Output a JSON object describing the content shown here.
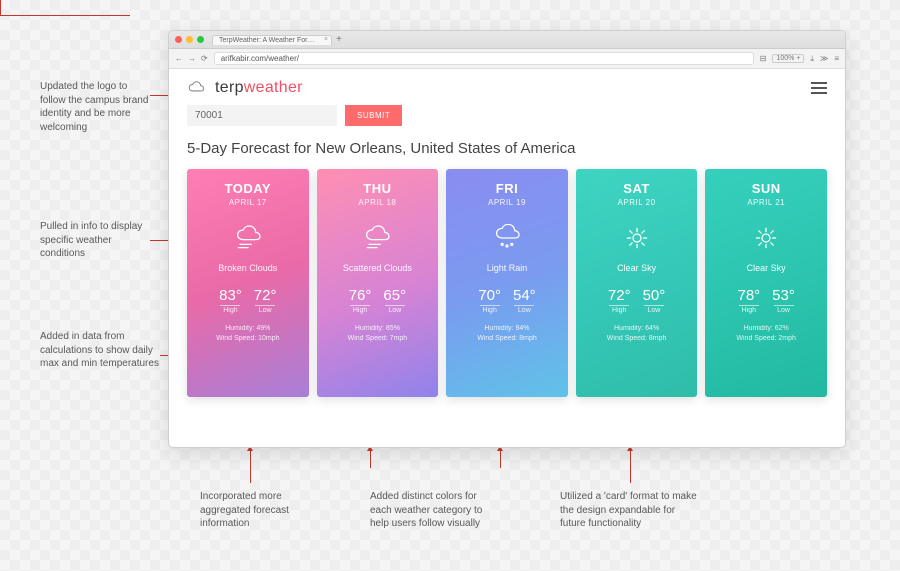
{
  "browser": {
    "tab_title": "TerpWeather: A Weather Forecast…",
    "url": "arifkabir.com/weather/",
    "zoom": "100%"
  },
  "logo": {
    "part1": "terp",
    "part2": "weather"
  },
  "search": {
    "zip_value": "70001",
    "submit_label": "SUBMIT"
  },
  "heading": "5-Day Forecast for New Orleans, United States of America",
  "forecast": [
    {
      "day": "TODAY",
      "date": "APRIL 17",
      "condition": "Broken Clouds",
      "icon": "cloud-wind",
      "high": "83°",
      "low": "72°",
      "humidity": "Humidity: 49%",
      "wind": "Wind Speed: 10mph"
    },
    {
      "day": "THU",
      "date": "APRIL 18",
      "condition": "Scattered Clouds",
      "icon": "cloud-wind",
      "high": "76°",
      "low": "65°",
      "humidity": "Humidity: 85%",
      "wind": "Wind Speed: 7mph"
    },
    {
      "day": "FRI",
      "date": "APRIL 19",
      "condition": "Light Rain",
      "icon": "cloud-rain",
      "high": "70°",
      "low": "54°",
      "humidity": "Humidity: 94%",
      "wind": "Wind Speed: 8mph"
    },
    {
      "day": "SAT",
      "date": "APRIL 20",
      "condition": "Clear Sky",
      "icon": "sun",
      "high": "72°",
      "low": "50°",
      "humidity": "Humidity: 64%",
      "wind": "Wind Speed: 8mph"
    },
    {
      "day": "SUN",
      "date": "APRIL 21",
      "condition": "Clear Sky",
      "icon": "sun",
      "high": "78°",
      "low": "53°",
      "humidity": "Humidity: 62%",
      "wind": "Wind Speed: 2mph"
    }
  ],
  "labels": {
    "high": "High",
    "low": "Low"
  },
  "annotations": {
    "a1": "Updated the logo to follow the campus brand identity and be more welcoming",
    "a2": "Pulled in info to display specific weather conditions",
    "a3": "Added in data from calculations to show daily max and min temperatures",
    "a4": "Incorporated more aggregated forecast information",
    "a5": "Added distinct colors for each weather category to help users follow visually",
    "a6": "Utilized a 'card' format to make the design expandable for future functionality"
  }
}
